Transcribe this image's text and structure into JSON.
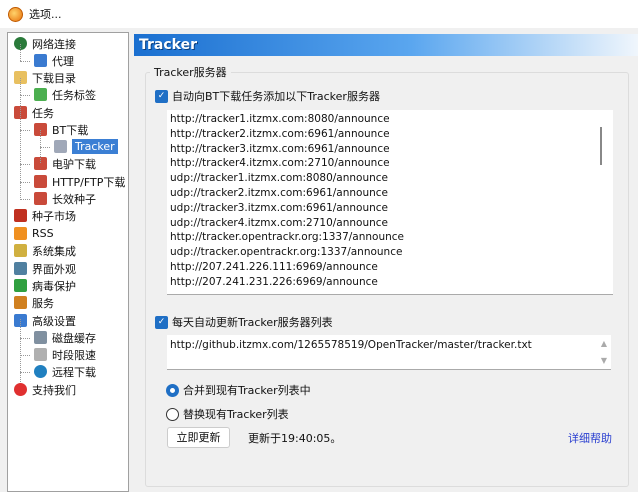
{
  "window": {
    "title": "选项..."
  },
  "tree": [
    {
      "label": "网络连接",
      "level": 0,
      "icon": "globe-icon",
      "color": "#2a7a3a"
    },
    {
      "label": "代理",
      "level": 1,
      "icon": "network-icon",
      "color": "#3a7ad0"
    },
    {
      "label": "下载目录",
      "level": 0,
      "icon": "folder-icon",
      "color": "#e8c060"
    },
    {
      "label": "任务标签",
      "level": 1,
      "icon": "tag-icon",
      "color": "#4caf50"
    },
    {
      "label": "任务",
      "level": 0,
      "icon": "task-icon",
      "color": "#c94a3a"
    },
    {
      "label": "BT下载",
      "level": 1,
      "icon": "task-icon",
      "color": "#c94a3a"
    },
    {
      "label": "Tracker",
      "level": 2,
      "icon": "server-icon",
      "color": "#a0a8b8",
      "selected": true
    },
    {
      "label": "电驴下载",
      "level": 1,
      "icon": "task-icon",
      "color": "#c94a3a"
    },
    {
      "label": "HTTP/FTP下载",
      "level": 1,
      "icon": "task-icon",
      "color": "#c94a3a"
    },
    {
      "label": "长效种子",
      "level": 1,
      "icon": "task-icon",
      "color": "#c94a3a"
    },
    {
      "label": "种子市场",
      "level": 0,
      "icon": "magnet-icon",
      "color": "#c03020"
    },
    {
      "label": "RSS",
      "level": 0,
      "icon": "rss-icon",
      "color": "#f09020"
    },
    {
      "label": "系统集成",
      "level": 0,
      "icon": "integration-icon",
      "color": "#d0b040"
    },
    {
      "label": "界面外观",
      "level": 0,
      "icon": "appearance-icon",
      "color": "#5080a0"
    },
    {
      "label": "病毒保护",
      "level": 0,
      "icon": "shield-icon",
      "color": "#30a040"
    },
    {
      "label": "服务",
      "level": 0,
      "icon": "users-icon",
      "color": "#d08020"
    },
    {
      "label": "高级设置",
      "level": 0,
      "icon": "advanced-icon",
      "color": "#3a7ad0"
    },
    {
      "label": "磁盘缓存",
      "level": 1,
      "icon": "disk-icon",
      "color": "#8090a0"
    },
    {
      "label": "时段限速",
      "level": 1,
      "icon": "clock-icon",
      "color": "#b0b0b0"
    },
    {
      "label": "远程下载",
      "level": 1,
      "icon": "remote-globe-icon",
      "color": "#2080c0"
    },
    {
      "label": "支持我们",
      "level": 0,
      "icon": "heart-icon",
      "color": "#e03030"
    }
  ],
  "panel": {
    "title": "Tracker",
    "group_label": "Tracker服务器",
    "auto_add_label": "自动向BT下载任务添加以下Tracker服务器",
    "trackers": [
      "http://tracker1.itzmx.com:8080/announce",
      "http://tracker2.itzmx.com:6961/announce",
      "http://tracker3.itzmx.com:6961/announce",
      "http://tracker4.itzmx.com:2710/announce",
      "udp://tracker1.itzmx.com:8080/announce",
      "udp://tracker2.itzmx.com:6961/announce",
      "udp://tracker3.itzmx.com:6961/announce",
      "udp://tracker4.itzmx.com:2710/announce",
      "http://tracker.opentrackr.org:1337/announce",
      "udp://tracker.opentrackr.org:1337/announce",
      "http://207.241.226.111:6969/announce",
      "http://207.241.231.226:6969/announce"
    ],
    "auto_update_label": "每天自动更新Tracker服务器列表",
    "update_url": "http://github.itzmx.com/1265578519/OpenTracker/master/tracker.txt",
    "merge_label": "合并到现有Tracker列表中",
    "replace_label": "替换现有Tracker列表",
    "update_now_label": "立即更新",
    "updated_at": "更新于19:40:05。",
    "help_link": "详细帮助",
    "accent": "#1f6fc5"
  }
}
